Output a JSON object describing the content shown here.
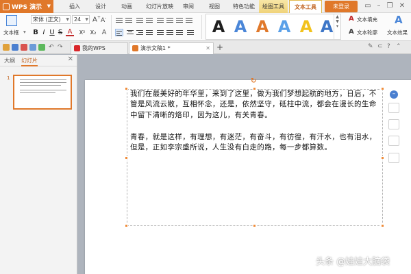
{
  "app": {
    "name": "WPS 演示",
    "login_label": "未登录"
  },
  "menu": {
    "tabs": [
      "插入",
      "设计",
      "动画",
      "幻灯片放映",
      "审阅",
      "视图",
      "特色功能",
      "绘图工具",
      "文本工具"
    ],
    "active_tab": "文本工具"
  },
  "ribbon": {
    "textbox_label": "文本框",
    "font_name": "宋体 (正文)",
    "font_size": "24",
    "text_fill_label": "文本填充",
    "text_outline_label": "文本轮廓",
    "text_effect_label": "文本效果",
    "format_buttons": [
      "B",
      "I",
      "U",
      "S",
      "A",
      "X²",
      "X₂",
      "A"
    ],
    "style_colors": [
      "#1f1f1f",
      "#4a86d8",
      "#e0782a",
      "#5aa0e8",
      "#f2c21b",
      "#3d76c7"
    ]
  },
  "tabbar": {
    "tabs": [
      {
        "label": "我的WPS",
        "active": false
      },
      {
        "label": "演示文稿1 *",
        "active": true
      }
    ],
    "new_tab_symbol": "+"
  },
  "panel": {
    "tabs": [
      "大纲",
      "幻灯片"
    ],
    "active_tab": "幻灯片",
    "slide_number": "1"
  },
  "slide": {
    "paragraph_1": "我们在最美好的年华里，来到了这里，做为我们梦想起航的地方，日后，不管是风流云散，互相怀念，还是，依然坚守，砥柱中流，都会在漫长的生命中留下清晰的烙印，因为这儿，有关青春。",
    "paragraph_2": "青春，就是这样，有理想，有迷茫，有奋斗，有彷徨，有汗水，也有泪水，但是，正如李宗盛所说，人生没有白走的路，每一步都算数。"
  },
  "watermark": "头条 @娃娃大脑袋"
}
